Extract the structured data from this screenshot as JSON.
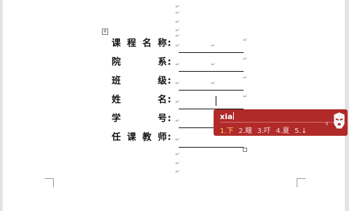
{
  "document": {
    "paragraph_mark": "↵",
    "table_handle": "+",
    "rows": [
      {
        "chars": [
          "课",
          "程",
          "名",
          "称"
        ],
        "colon": ":"
      },
      {
        "chars": [
          "院",
          "",
          "",
          "系"
        ],
        "colon": ":"
      },
      {
        "chars": [
          "班",
          "",
          "",
          "级"
        ],
        "colon": ":"
      },
      {
        "chars": [
          "姓",
          "",
          "",
          "名"
        ],
        "colon": ":"
      },
      {
        "chars": [
          "学",
          "",
          "",
          "号"
        ],
        "colon": ":"
      },
      {
        "chars": [
          "任",
          "课",
          "教",
          "师"
        ],
        "colon": ":"
      }
    ]
  },
  "ime": {
    "input": "xia",
    "candidates": [
      "1.下",
      "2.瞎",
      "3.吓",
      "4.夏",
      "5.↓"
    ],
    "prev_arrow": "‹",
    "brand_colors": {
      "bar": "#b12a2a",
      "selected": "#ffd35c"
    }
  }
}
